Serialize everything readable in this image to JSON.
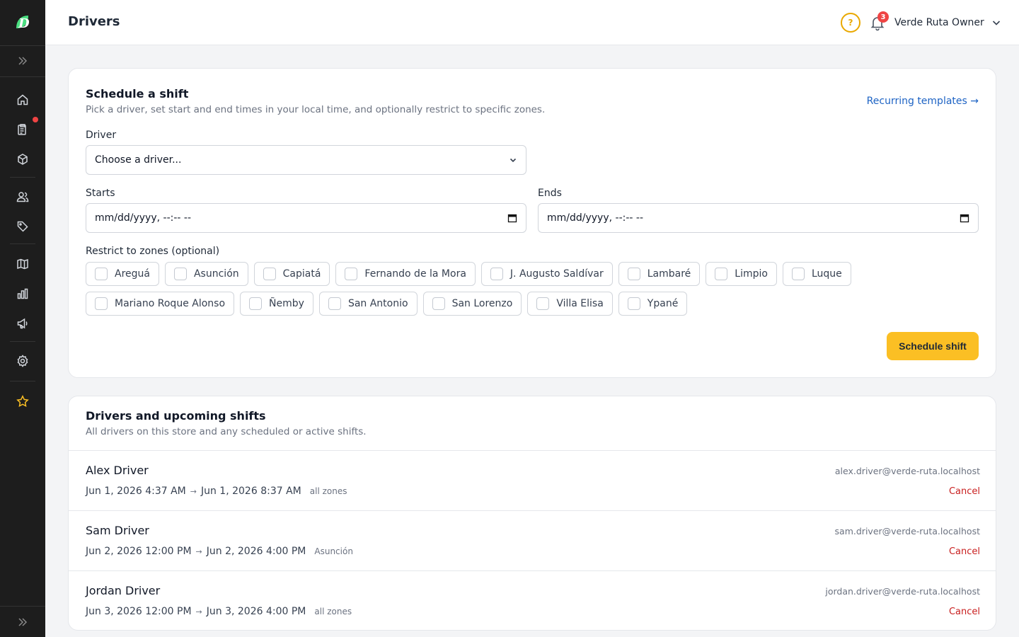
{
  "header": {
    "title": "Drivers",
    "help_label": "?",
    "notification_count": "3",
    "user_name": "Verde Ruta Owner"
  },
  "sidebar": {
    "items": [
      {
        "icon": "home-icon"
      },
      {
        "icon": "orders-icon",
        "has_dot": true
      },
      {
        "icon": "box-icon"
      },
      {
        "icon": "users-icon"
      },
      {
        "icon": "tag-icon"
      },
      {
        "icon": "map-icon"
      },
      {
        "icon": "bar-chart-icon"
      },
      {
        "icon": "megaphone-icon"
      },
      {
        "icon": "gear-icon"
      },
      {
        "icon": "star-icon"
      }
    ]
  },
  "schedule": {
    "title": "Schedule a shift",
    "subtitle": "Pick a driver, set start and end times in your local time, and optionally restrict to specific zones.",
    "recurring_link": "Recurring templates →",
    "driver_label": "Driver",
    "driver_placeholder": "Choose a driver...",
    "starts_label": "Starts",
    "starts_value": "mm/dd/yyyy, --:-- --",
    "ends_label": "Ends",
    "ends_value": "mm/dd/yyyy, --:-- --",
    "zones_label": "Restrict to zones (optional)",
    "zones": [
      "Areguá",
      "Asunción",
      "Capiatá",
      "Fernando de la Mora",
      "J. Augusto Saldívar",
      "Lambaré",
      "Limpio",
      "Luque",
      "Mariano Roque Alonso",
      "Ñemby",
      "San Antonio",
      "San Lorenzo",
      "Villa Elisa",
      "Ypané"
    ],
    "submit_label": "Schedule shift"
  },
  "shifts": {
    "title": "Drivers and upcoming shifts",
    "subtitle": "All drivers on this store and any scheduled or active shifts.",
    "rows": [
      {
        "name": "Alex Driver",
        "start": "Jun 1, 2026 4:37 AM",
        "end": "Jun 1, 2026 8:37 AM",
        "zones": "all zones",
        "email": "alex.driver@verde-ruta.localhost",
        "cancel": "Cancel"
      },
      {
        "name": "Sam Driver",
        "start": "Jun 2, 2026 12:00 PM",
        "end": "Jun 2, 2026 4:00 PM",
        "zones": "Asunción",
        "email": "sam.driver@verde-ruta.localhost",
        "cancel": "Cancel"
      },
      {
        "name": "Jordan Driver",
        "start": "Jun 3, 2026 12:00 PM",
        "end": "Jun 3, 2026 4:00 PM",
        "zones": "all zones",
        "email": "jordan.driver@verde-ruta.localhost",
        "cancel": "Cancel"
      }
    ],
    "arrow": "→"
  },
  "colors": {
    "accent": "#fbbf24",
    "link": "#1d63c4",
    "danger": "#c81e1e",
    "sidebar_bg": "#1d1d1d"
  }
}
